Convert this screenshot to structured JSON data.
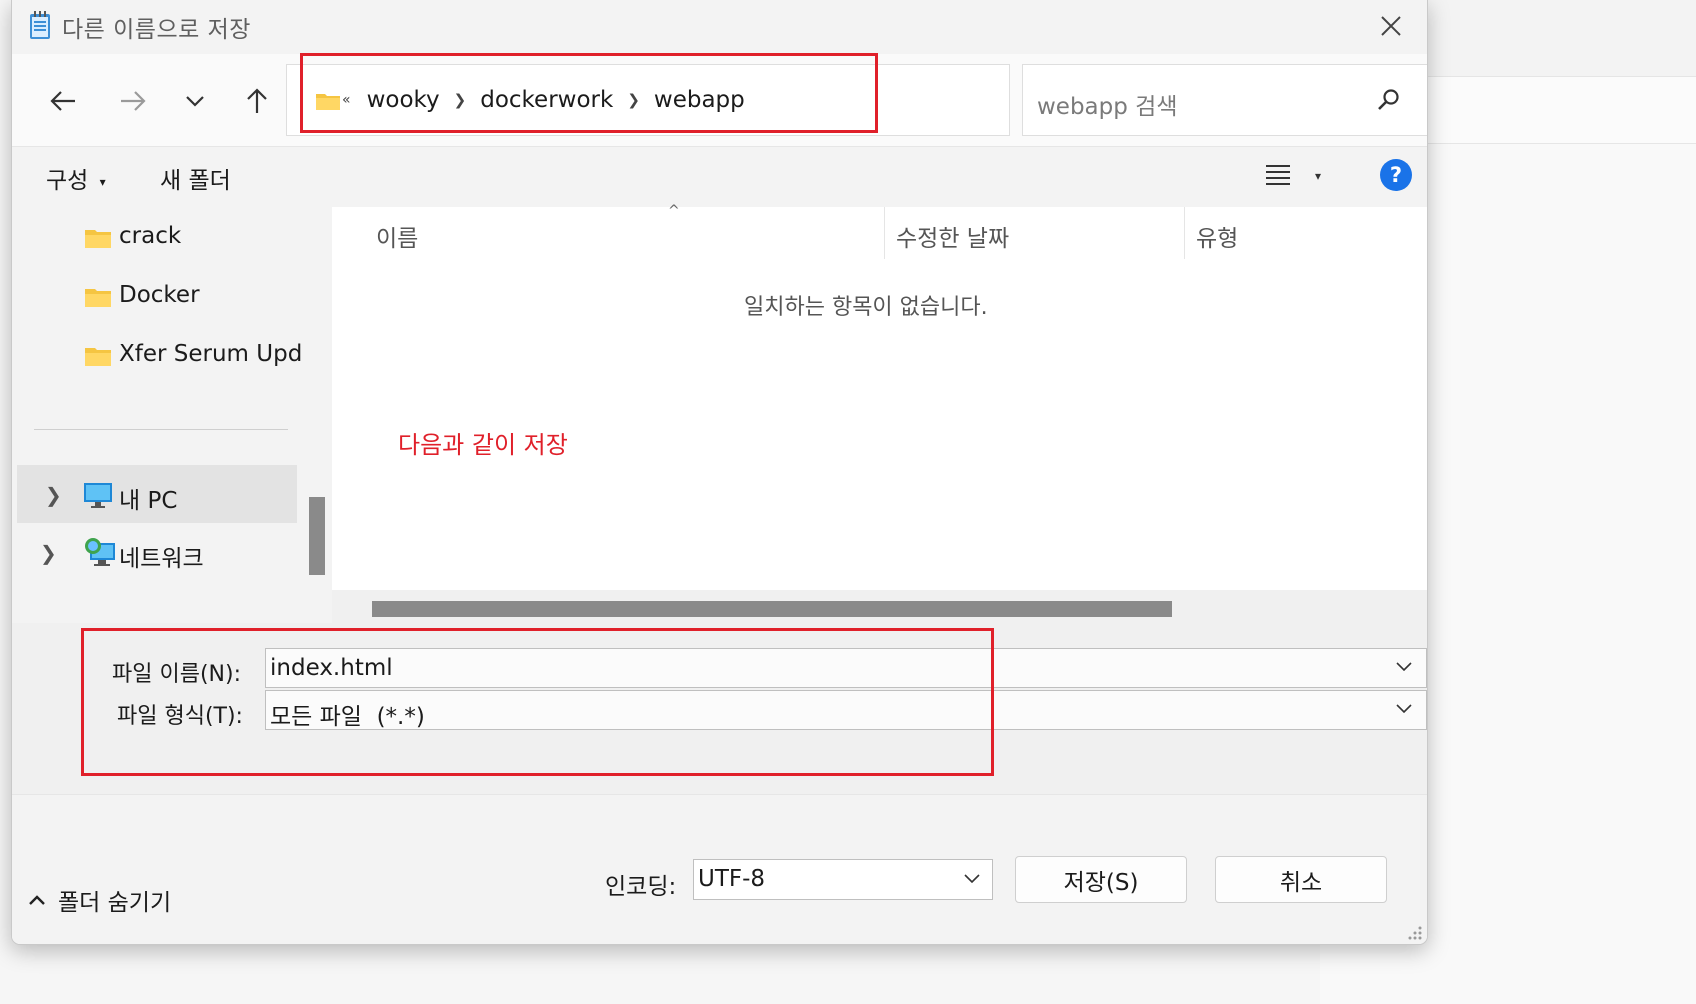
{
  "dialog": {
    "title": "다른 이름으로 저장",
    "icon": "notepad-icon"
  },
  "nav": {
    "back": "back-arrow-icon",
    "forward": "forward-arrow-icon",
    "recent": "chevron-down-icon",
    "up": "up-arrow-icon",
    "overflow": "«",
    "breadcrumbs": [
      "wooky",
      "dockerwork",
      "webapp"
    ],
    "search_placeholder": "webapp 검색"
  },
  "toolbar": {
    "organize": "구성",
    "new_folder": "새 폴더",
    "help": "?"
  },
  "sidebar": {
    "items": [
      {
        "label": "crack"
      },
      {
        "label": "Docker"
      },
      {
        "label": "Xfer Serum Upd"
      },
      {
        "label": "내 PC"
      },
      {
        "label": "네트워크"
      }
    ]
  },
  "columns": [
    "이름",
    "수정한 날짜",
    "유형"
  ],
  "empty_message": "일치하는 항목이 없습니다.",
  "annotation": "다음과 같이 저장",
  "form": {
    "filename_label": "파일 이름(N):",
    "filename_value": "index.html",
    "filetype_label": "파일 형식(T):",
    "filetype_value": "모든 파일  (*.*)"
  },
  "footer": {
    "hide_folders": "폴더 숨기기",
    "encoding_label": "인코딩:",
    "encoding_value": "UTF-8",
    "save": "저장(S)",
    "cancel": "취소"
  },
  "colors": {
    "annotation_red": "#e0202a",
    "help_blue": "#1a73e8",
    "folder_yellow": "#f5c542"
  }
}
